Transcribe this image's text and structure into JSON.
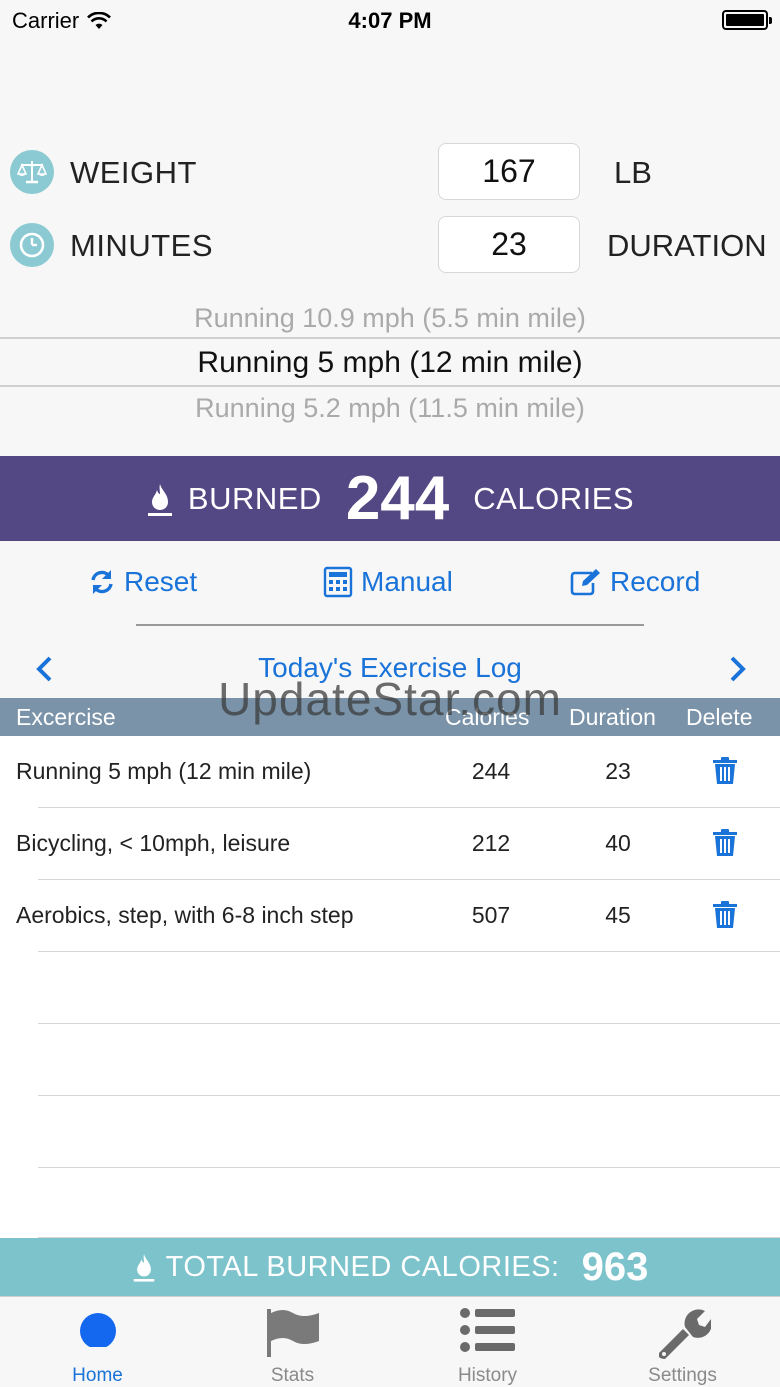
{
  "status_bar": {
    "carrier": "Carrier",
    "time": "4:07 PM"
  },
  "inputs": {
    "weight": {
      "label": "WEIGHT",
      "value": "167",
      "unit": "LB"
    },
    "minutes": {
      "label": "MINUTES",
      "value": "23",
      "unit": "DURATION"
    }
  },
  "picker": {
    "above": "Running 10.9 mph (5.5 min mile)",
    "selected": "Running 5 mph (12 min mile)",
    "below": "Running 5.2 mph (11.5 min mile)"
  },
  "burned": {
    "prefix": "BURNED",
    "value": "244",
    "suffix": "CALORIES"
  },
  "actions": {
    "reset": "Reset",
    "manual": "Manual",
    "record": "Record"
  },
  "log": {
    "title": "Today's Exercise Log",
    "columns": {
      "exercise": "Excercise",
      "calories": "Calories",
      "duration": "Duration",
      "delete": "Delete"
    },
    "rows": [
      {
        "exercise": "Running 5 mph (12 min mile)",
        "calories": "244",
        "duration": "23"
      },
      {
        "exercise": "Bicycling, < 10mph, leisure",
        "calories": "212",
        "duration": "40"
      },
      {
        "exercise": "Aerobics, step, with 6-8 inch step",
        "calories": "507",
        "duration": "45"
      }
    ]
  },
  "watermark": "UpdateStar.com",
  "total": {
    "label": "TOTAL BURNED CALORIES:",
    "value": "963"
  },
  "tabs": [
    {
      "label": "Home",
      "icon": "circle-icon",
      "active": true
    },
    {
      "label": "Stats",
      "icon": "flag-icon",
      "active": false
    },
    {
      "label": "History",
      "icon": "list-icon",
      "active": false
    },
    {
      "label": "Settings",
      "icon": "wrench-icon",
      "active": false
    }
  ],
  "colors": {
    "accent": "#1a73d9",
    "burn_banner": "#534784",
    "total_banner": "#7dc3cc",
    "table_header": "#7a93a9",
    "icon_circle": "#8ccad3"
  }
}
